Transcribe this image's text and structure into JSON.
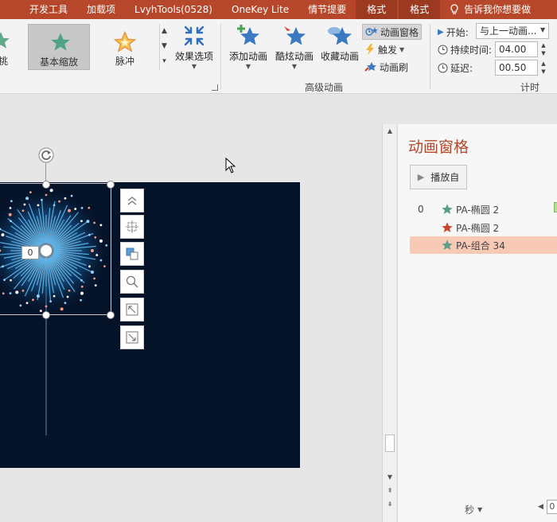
{
  "tabs": [
    "开发工具",
    "加载项",
    "LvyhTools(0528)",
    "OneKey Lite",
    "情节提要",
    "格式",
    "格式"
  ],
  "tell_me": "告诉我你想要做",
  "gallery": {
    "items": [
      {
        "label": "挑",
        "icon": "star-icon"
      },
      {
        "label": "基本缩放",
        "icon": "star-icon"
      },
      {
        "label": "脉冲",
        "icon": "star-icon"
      }
    ],
    "selected": "基本缩放"
  },
  "effect_options": "效果选项",
  "advanced": {
    "add_animation": "添加动画",
    "cool_animation": "酷炫动画",
    "fav_animation": "收藏动画",
    "group_label": "高级动画",
    "pane_toggle": "动画窗格",
    "trigger": "触发",
    "painter": "动画刷"
  },
  "timing": {
    "start_label": "开始:",
    "start_value": "与上一动画...",
    "duration_label": "持续时间:",
    "duration_value": "04.00",
    "delay_label": "延迟:",
    "delay_value": "00.50",
    "group_label": "计时"
  },
  "slide": {
    "tag": "0"
  },
  "pane": {
    "title": "动画窗格",
    "play_button": "播放自",
    "rows": [
      {
        "num": "0",
        "name": "PA-椭圆 2",
        "star_color": "#5a9e84",
        "selected": false
      },
      {
        "num": "",
        "name": "PA-椭圆 2",
        "star_color": "#c7452b",
        "selected": false
      },
      {
        "num": "",
        "name": "PA-组合 34",
        "star_color": "#5a9e84",
        "selected": true
      }
    ],
    "seconds_label": "秒",
    "zoom_value": "0"
  },
  "colors": {
    "accent": "#b7472a",
    "slide_bg": "#051329",
    "selection": "#f8c9b5"
  }
}
